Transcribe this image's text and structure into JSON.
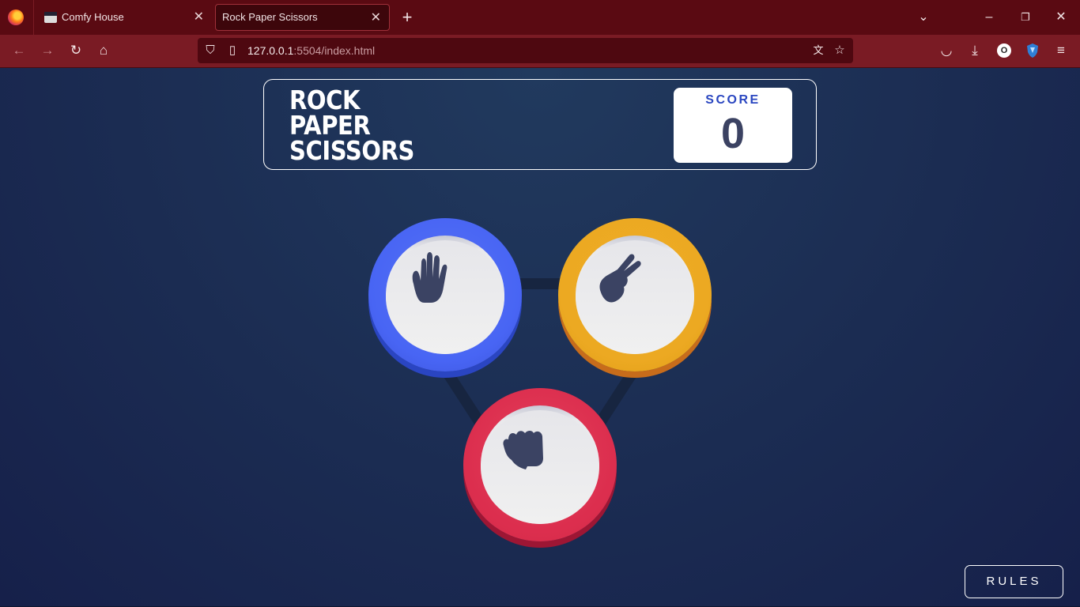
{
  "browser": {
    "tabs": [
      {
        "title": "Comfy House",
        "active": false
      },
      {
        "title": "Rock Paper Scissors",
        "active": true
      }
    ],
    "url": {
      "host": "127.0.0.1",
      "path": ":5504/index.html"
    },
    "profile_initial": "O",
    "accent_color": "#5a0a12"
  },
  "game": {
    "title_lines": [
      "ROCK",
      "PAPER",
      "SCISSORS"
    ],
    "score": {
      "label": "SCORE",
      "value": "0"
    },
    "choices": [
      {
        "name": "paper",
        "icon": "hand-paper-icon",
        "ring_color": "#4865f4"
      },
      {
        "name": "scissors",
        "icon": "hand-scissors-icon",
        "ring_color": "#eca922"
      },
      {
        "name": "rock",
        "icon": "hand-rock-icon",
        "ring_color": "#dc2e4e"
      }
    ],
    "rules_label": "RULES"
  }
}
